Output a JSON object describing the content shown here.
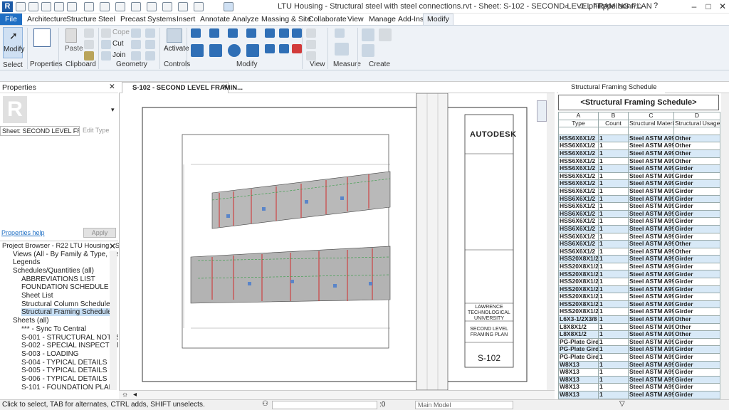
{
  "app": {
    "logo": "R",
    "title": "LTU Housing - Structural steel with steel connections.rvt - Sheet: S-102 - SECOND LEVEL FRAMING PLAN",
    "user": "philippe.bonn..."
  },
  "tabs": [
    {
      "label": "File"
    },
    {
      "label": "Architecture"
    },
    {
      "label": "Structure"
    },
    {
      "label": "Steel"
    },
    {
      "label": "Precast"
    },
    {
      "label": "Systems"
    },
    {
      "label": "Insert"
    },
    {
      "label": "Annotate"
    },
    {
      "label": "Analyze"
    },
    {
      "label": "Massing & Site"
    },
    {
      "label": "Collaborate"
    },
    {
      "label": "View"
    },
    {
      "label": "Manage"
    },
    {
      "label": "Add-Ins"
    },
    {
      "label": "Modify"
    }
  ],
  "ribbon": {
    "modify_label": "Modify",
    "select_label": "Select",
    "properties_label": "Properties",
    "clipboard_label": "Clipboard",
    "paste_label": "Paste",
    "cope_label": "Cope",
    "cut_label": "Cut",
    "join_label": "Join",
    "geometry_label": "Geometry",
    "activate_label": "Activate",
    "controls_label": "Controls",
    "modify_panel_label": "Modify",
    "view_label": "View",
    "measure_label": "Measure",
    "create_label": "Create"
  },
  "properties": {
    "title": "Properties",
    "type_selector": "Sheet: SECOND LEVEL FRAM",
    "edit_type": "Edit Type",
    "help_link": "Properties help",
    "apply": "Apply"
  },
  "project_browser": {
    "title": "Project Browser - R22 LTU Housing - Str...",
    "items": [
      {
        "label": "Views (All - By Family & Type, then"
      },
      {
        "label": "Legends"
      },
      {
        "label": "Schedules/Quantities (all)"
      },
      {
        "label": "ABBREVIATIONS LIST"
      },
      {
        "label": "FOUNDATION SCHEDULE"
      },
      {
        "label": "Sheet List"
      },
      {
        "label": "Structural Column Schedule"
      },
      {
        "label": "Structural Framing Schedule"
      },
      {
        "label": "Sheets (all)"
      },
      {
        "label": "*** - Sync To Central"
      },
      {
        "label": "S-001 - STRUCTURAL NOTES"
      },
      {
        "label": "S-002 - SPECIAL INSPECTIONS"
      },
      {
        "label": "S-003 - LOADING"
      },
      {
        "label": "S-004 - TYPICAL DETAILS"
      },
      {
        "label": "S-005 - TYPICAL DETAILS"
      },
      {
        "label": "S-006 - TYPICAL DETAILS"
      },
      {
        "label": "S-101 - FOUNDATION PLAN"
      }
    ]
  },
  "view": {
    "tab_title": "S-102 - SECOND LEVEL FRAMIN...",
    "titleblock": {
      "brand": "AUTODESK",
      "client": "LAWRENCE TECHNOLOGICAL UNIVERSITY",
      "sheet_name": "SECOND LEVEL FRAMING PLAN",
      "sheet_number": "S-102"
    }
  },
  "schedule": {
    "tab_title": "Structural Framing Schedule",
    "title": "<Structural Framing Schedule>",
    "col_letters": [
      "A",
      "B",
      "C",
      "D"
    ],
    "headers": [
      "Type",
      "Count",
      "Structural Materia",
      "Structural Usage"
    ],
    "rows": [
      [
        "HSS6X6X1/2",
        "1",
        "Steel ASTM A99",
        "Other"
      ],
      [
        "HSS6X6X1/2",
        "1",
        "Steel ASTM A99",
        "Other"
      ],
      [
        "HSS6X6X1/2",
        "1",
        "Steel ASTM A99",
        "Other"
      ],
      [
        "HSS6X6X1/2",
        "1",
        "Steel ASTM A99",
        "Other"
      ],
      [
        "HSS6X6X1/2",
        "1",
        "Steel ASTM A99",
        "Girder"
      ],
      [
        "HSS6X6X1/2",
        "1",
        "Steel ASTM A99",
        "Girder"
      ],
      [
        "HSS6X6X1/2",
        "1",
        "Steel ASTM A99",
        "Girder"
      ],
      [
        "HSS6X6X1/2",
        "1",
        "Steel ASTM A99",
        "Girder"
      ],
      [
        "HSS6X6X1/2",
        "1",
        "Steel ASTM A99",
        "Girder"
      ],
      [
        "HSS6X6X1/2",
        "1",
        "Steel ASTM A99",
        "Girder"
      ],
      [
        "HSS6X6X1/2",
        "1",
        "Steel ASTM A99",
        "Girder"
      ],
      [
        "HSS6X6X1/2",
        "1",
        "Steel ASTM A99",
        "Girder"
      ],
      [
        "HSS6X6X1/2",
        "1",
        "Steel ASTM A99",
        "Girder"
      ],
      [
        "HSS6X6X1/2",
        "1",
        "Steel ASTM A99",
        "Girder"
      ],
      [
        "HSS6X6X1/2",
        "1",
        "Steel ASTM A99",
        "Other"
      ],
      [
        "HSS6X6X1/2",
        "1",
        "Steel ASTM A99",
        "Other"
      ],
      [
        "HSS20X8X1/2",
        "1",
        "Steel ASTM A99",
        "Girder"
      ],
      [
        "HSS20X8X1/2",
        "1",
        "Steel ASTM A99",
        "Girder"
      ],
      [
        "HSS20X8X1/2",
        "1",
        "Steel ASTM A99",
        "Girder"
      ],
      [
        "HSS20X8X1/2",
        "1",
        "Steel ASTM A99",
        "Girder"
      ],
      [
        "HSS20X8X1/2",
        "1",
        "Steel ASTM A99",
        "Girder"
      ],
      [
        "HSS20X8X1/2",
        "1",
        "Steel ASTM A99",
        "Girder"
      ],
      [
        "HSS20X8X1/2",
        "1",
        "Steel ASTM A99",
        "Girder"
      ],
      [
        "HSS20X8X1/2",
        "1",
        "Steel ASTM A99",
        "Girder"
      ],
      [
        "L6X3-1/2X3/8",
        "1",
        "Steel ASTM A99",
        "Other"
      ],
      [
        "L8X8X1/2",
        "1",
        "Steel ASTM A99",
        "Other"
      ],
      [
        "L8X8X1/2",
        "1",
        "Steel ASTM A99",
        "Other"
      ],
      [
        "PG-Plate Girder",
        "1",
        "Steel ASTM A99",
        "Girder"
      ],
      [
        "PG-Plate Girder",
        "1",
        "Steel ASTM A99",
        "Girder"
      ],
      [
        "PG-Plate Girder",
        "1",
        "Steel ASTM A99",
        "Girder"
      ],
      [
        "W8X13",
        "1",
        "Steel ASTM A99",
        "Girder"
      ],
      [
        "W8X13",
        "1",
        "Steel ASTM A99",
        "Girder"
      ],
      [
        "W8X13",
        "1",
        "Steel ASTM A99",
        "Girder"
      ],
      [
        "W8X13",
        "1",
        "Steel ASTM A99",
        "Girder"
      ],
      [
        "W8X13",
        "1",
        "Steel ASTM A99",
        "Girder"
      ]
    ]
  },
  "status": {
    "message": "Click to select, TAB for alternates, CTRL adds, SHIFT unselects.",
    "zero": ":0",
    "model": "Main Model"
  }
}
